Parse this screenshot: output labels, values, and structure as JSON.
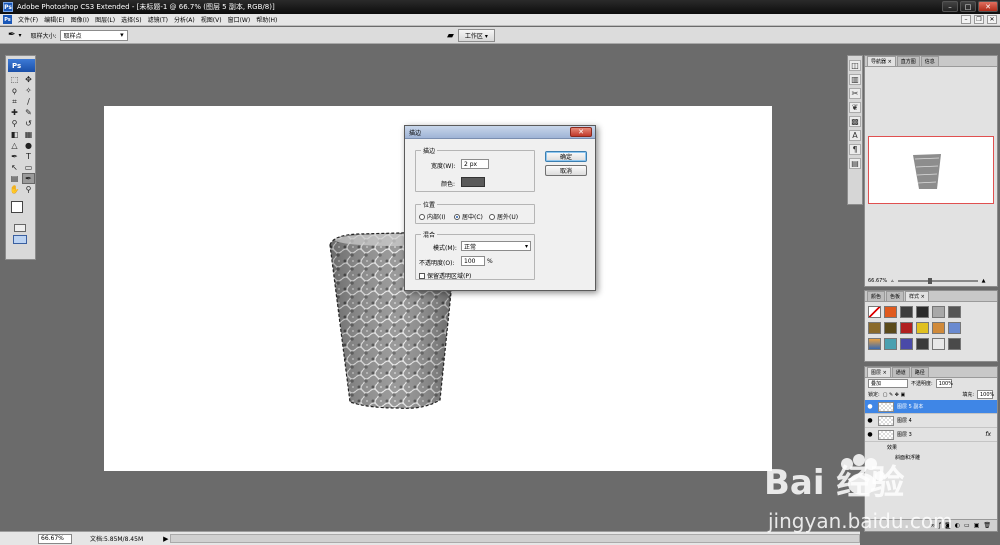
{
  "titlebar": {
    "app_icon": "Ps",
    "title": "Adobe Photoshop CS3 Extended - [未标题-1 @ 66.7% (图层 5 副本, RGB/8)]"
  },
  "menu": {
    "logo": "Ps",
    "items": [
      "文件(F)",
      "编辑(E)",
      "图像(I)",
      "图层(L)",
      "选择(S)",
      "滤镜(T)",
      "分析(A)",
      "视图(V)",
      "窗口(W)",
      "帮助(H)"
    ]
  },
  "options": {
    "sample_size_label": "取样大小:",
    "sample_size_value": "取样点",
    "workspace_label": "工作区 ▾"
  },
  "tools": {
    "logo": "Ps"
  },
  "status": {
    "zoom": "66.67%",
    "doc_info": "文档:5.85M/8.45M",
    "arrow": "▶"
  },
  "navigator": {
    "tabs": [
      "导航器 ×",
      "直方图",
      "信息"
    ],
    "zoom": "66.67%"
  },
  "styles": {
    "tabs": [
      "颜色",
      "色板",
      "样式 ×"
    ]
  },
  "layers": {
    "tabs": [
      "图层 ×",
      "通道",
      "路径"
    ],
    "blend_mode": "叠加",
    "opacity_label": "不透明度:",
    "opacity_value": "100%",
    "lock_label": "锁定:",
    "fill_label": "填充:",
    "fill_value": "100%",
    "rows": [
      {
        "name": "图层 5 副本",
        "selected": true
      },
      {
        "name": "图层 4",
        "selected": false
      },
      {
        "name": "图层 3",
        "selected": false,
        "fx": "fx"
      }
    ],
    "effects_label": "效果",
    "effect_item": "斜面和浮雕"
  },
  "dialog": {
    "title": "描边",
    "close": "✕",
    "stroke_group": "描边",
    "width_label": "宽度(W):",
    "width_value": "2 px",
    "color_label": "颜色:",
    "location_group": "位置",
    "radio_inside": "内部(I)",
    "radio_center": "居中(C)",
    "radio_outside": "居外(U)",
    "blend_group": "混合",
    "mode_label": "模式(M):",
    "mode_value": "正常",
    "opacity_label": "不透明度(O):",
    "opacity_value": "100",
    "opacity_unit": "%",
    "preserve_label": "保留透明区域(P)",
    "ok": "确定",
    "cancel": "取消"
  },
  "watermark": {
    "brand": "Bai 经验",
    "url": "jingyan.baidu.com"
  },
  "colors": {
    "selected_layer": "#3f86e6",
    "dialog_stroke_color": "#5a5a5a",
    "ps_blue": "#1b58b8"
  }
}
